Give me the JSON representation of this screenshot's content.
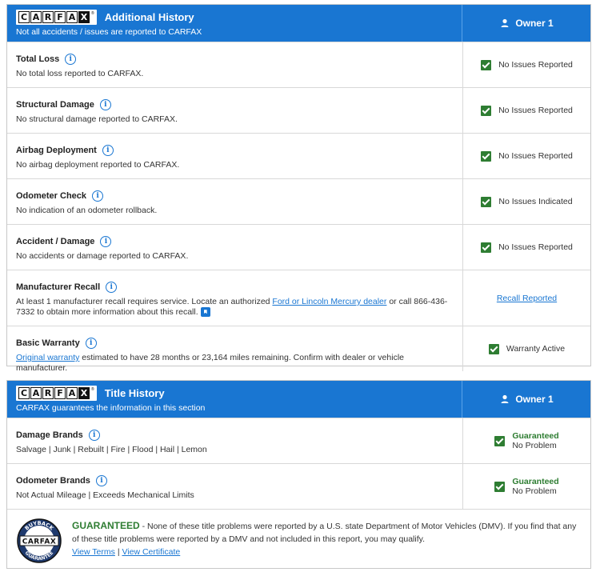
{
  "brand": {
    "logo_letters": [
      "C",
      "A",
      "R",
      "F",
      "A",
      "X"
    ]
  },
  "additional": {
    "title": "Additional History",
    "subtitle": "Not all accidents / issues are reported to CARFAX",
    "owner": "Owner 1",
    "rows": [
      {
        "title": "Total Loss",
        "desc": "No total loss reported to CARFAX.",
        "status": "No Issues Reported"
      },
      {
        "title": "Structural Damage",
        "desc": "No structural damage reported to CARFAX.",
        "status": "No Issues Reported"
      },
      {
        "title": "Airbag Deployment",
        "desc": "No airbag deployment reported to CARFAX.",
        "status": "No Issues Reported"
      },
      {
        "title": "Odometer Check",
        "desc": "No indication of an odometer rollback.",
        "status": "No Issues Indicated"
      },
      {
        "title": "Accident / Damage",
        "desc": "No accidents or damage reported to CARFAX.",
        "status": "No Issues Reported"
      }
    ],
    "recall": {
      "title": "Manufacturer Recall",
      "desc_pre": "At least 1 manufacturer recall requires service. Locate an authorized ",
      "desc_link": "Ford or Lincoln Mercury dealer",
      "desc_post": " or call 866-436-7332 to obtain more information about this recall.",
      "status_link": "Recall Reported"
    },
    "warranty": {
      "title": "Basic Warranty",
      "desc_link": "Original warranty",
      "desc_post": " estimated to have 28 months or 23,164 miles remaining. Confirm with dealer or vehicle manufacturer.",
      "status": "Warranty Active"
    }
  },
  "title_history": {
    "title": "Title History",
    "subtitle": "CARFAX guarantees the information in this section",
    "owner": "Owner 1",
    "rows": [
      {
        "title": "Damage Brands",
        "desc": "Salvage | Junk | Rebuilt | Fire | Flood | Hail | Lemon",
        "guaranteed": "Guaranteed",
        "result": "No Problem"
      },
      {
        "title": "Odometer Brands",
        "desc": "Not Actual Mileage | Exceeds Mechanical Limits",
        "guaranteed": "Guaranteed",
        "result": "No Problem"
      }
    ],
    "footer": {
      "badge_top": "BUYBACK",
      "badge_bottom": "GUARANTEE",
      "headline": "GUARANTEED",
      "text": " - None of these title problems were reported by a U.S. state Department of Motor Vehicles (DMV). If you find that any of these title problems were reported by a DMV and not included in this report, you may qualify.",
      "link_terms": "View Terms",
      "separator": "|",
      "link_cert": "View Certificate"
    }
  }
}
